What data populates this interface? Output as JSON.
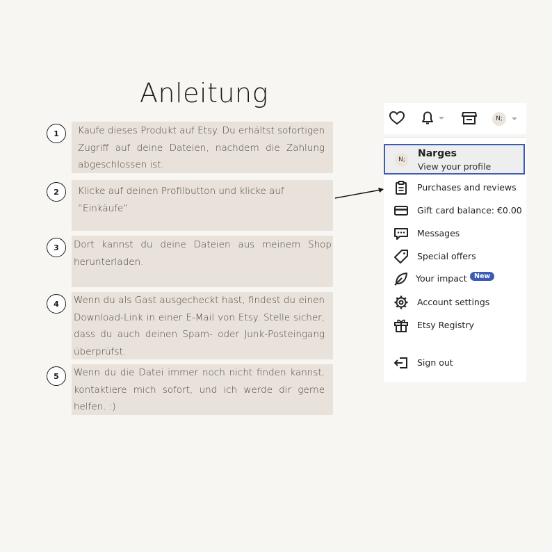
{
  "title": "Anleitung",
  "steps": [
    {
      "num": "1",
      "text": "Kaufe dieses Produkt auf Etsy. Du erhältst sofortigen Zugriff auf deine Dateien, nachdem die Zahlung abgeschlossen ist."
    },
    {
      "num": "2",
      "text": "Klicke auf deinen Profilbutton und klicke auf “Einkäufe”"
    },
    {
      "num": "3",
      "text": "Dort kannst du deine Dateien aus meinem Shop herunterladen."
    },
    {
      "num": "4",
      "text": "Wenn du als Gast ausgecheckt hast, findest du einen Download-Link in einer E-Mail von Etsy. Stelle sicher, dass du auch deinen Spam- oder Junk-Posteingang überprüfst."
    },
    {
      "num": "5",
      "text": "Wenn du die Datei immer noch nicht finden kannst, kontaktiere mich sofort, und ich werde dir gerne helfen. :)"
    }
  ],
  "topbar": {
    "icons": [
      "heart-icon",
      "bell-icon",
      "shop-icon",
      "avatar"
    ],
    "avatar_initials": "N;"
  },
  "menu": {
    "profile_name": "Narges",
    "profile_sub": "View your profile",
    "items": [
      {
        "label": "Purchases and reviews",
        "icon": "clipboard-icon"
      },
      {
        "label": "Gift card balance: €0.00",
        "icon": "card-icon"
      },
      {
        "label": "Messages",
        "icon": "message-icon"
      },
      {
        "label": "Special offers",
        "icon": "tag-icon"
      },
      {
        "label": "Your impact",
        "icon": "leaf-icon",
        "badge": "New"
      },
      {
        "label": "Account settings",
        "icon": "gear-icon"
      },
      {
        "label": "Etsy Registry",
        "icon": "gift-icon"
      },
      {
        "label": "Sign out",
        "icon": "signout-icon"
      }
    ]
  },
  "colors": {
    "background": "#f8f6f2",
    "step_box": "#e8e2da",
    "accent_blue": "#3b5bb5"
  }
}
